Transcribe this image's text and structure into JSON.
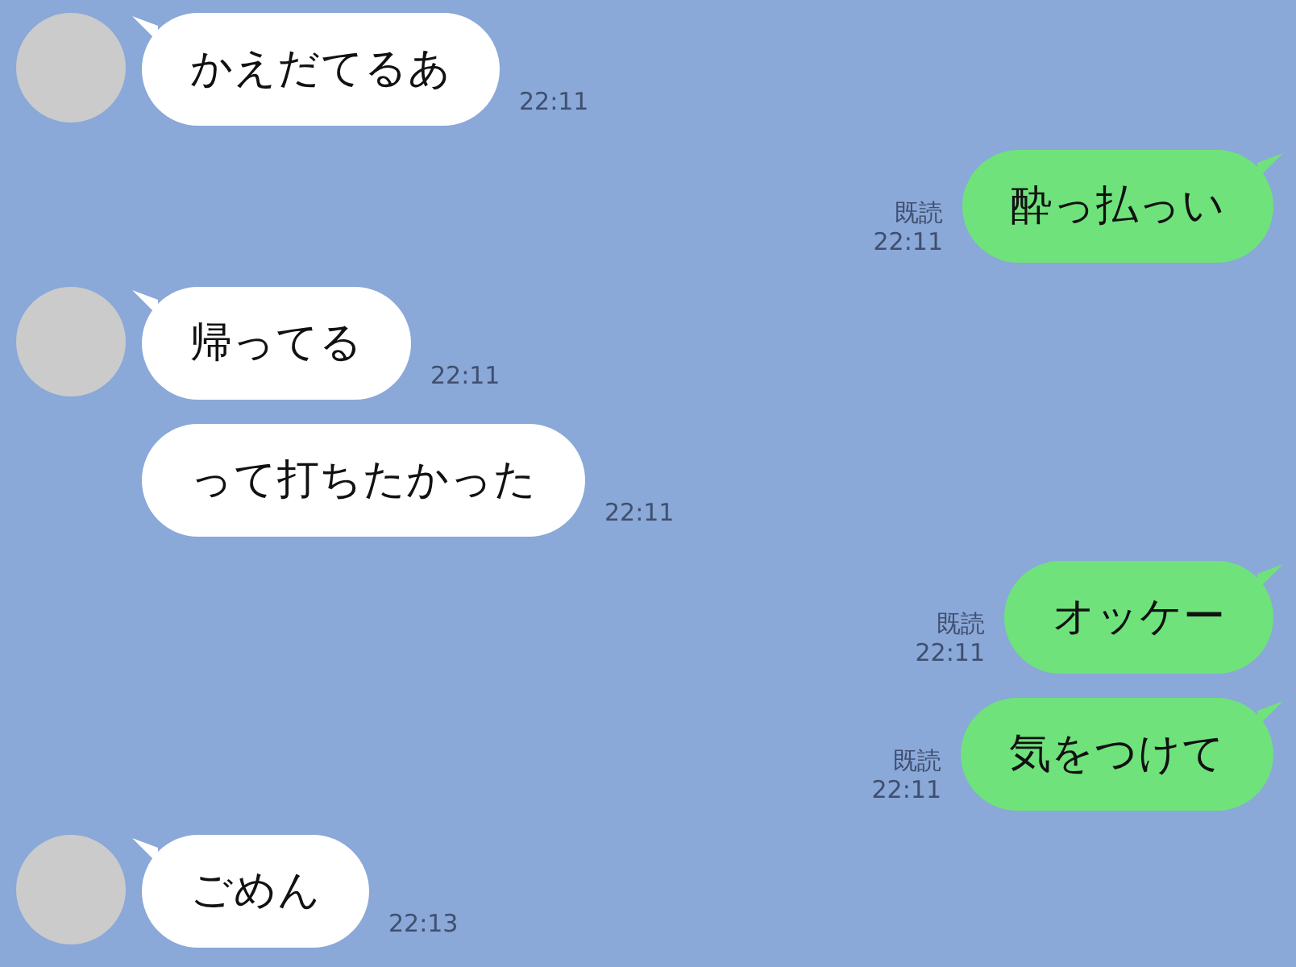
{
  "messages": [
    {
      "kind": "incoming",
      "avatar": true,
      "text": "かえだてるあ",
      "time": "22:11"
    },
    {
      "kind": "outgoing",
      "read": "既読",
      "text": "酔っ払っい",
      "time": "22:11"
    },
    {
      "kind": "incoming",
      "avatar": true,
      "text": "帰ってる",
      "time": "22:11"
    },
    {
      "kind": "incoming",
      "avatar": false,
      "text": "って打ちたかった",
      "time": "22:11"
    },
    {
      "kind": "outgoing",
      "read": "既読",
      "text": "オッケー",
      "time": "22:11"
    },
    {
      "kind": "outgoing",
      "read": "既読",
      "text": "気をつけて",
      "time": "22:11"
    },
    {
      "kind": "incoming",
      "avatar": true,
      "text": "ごめん",
      "time": "22:13"
    }
  ]
}
